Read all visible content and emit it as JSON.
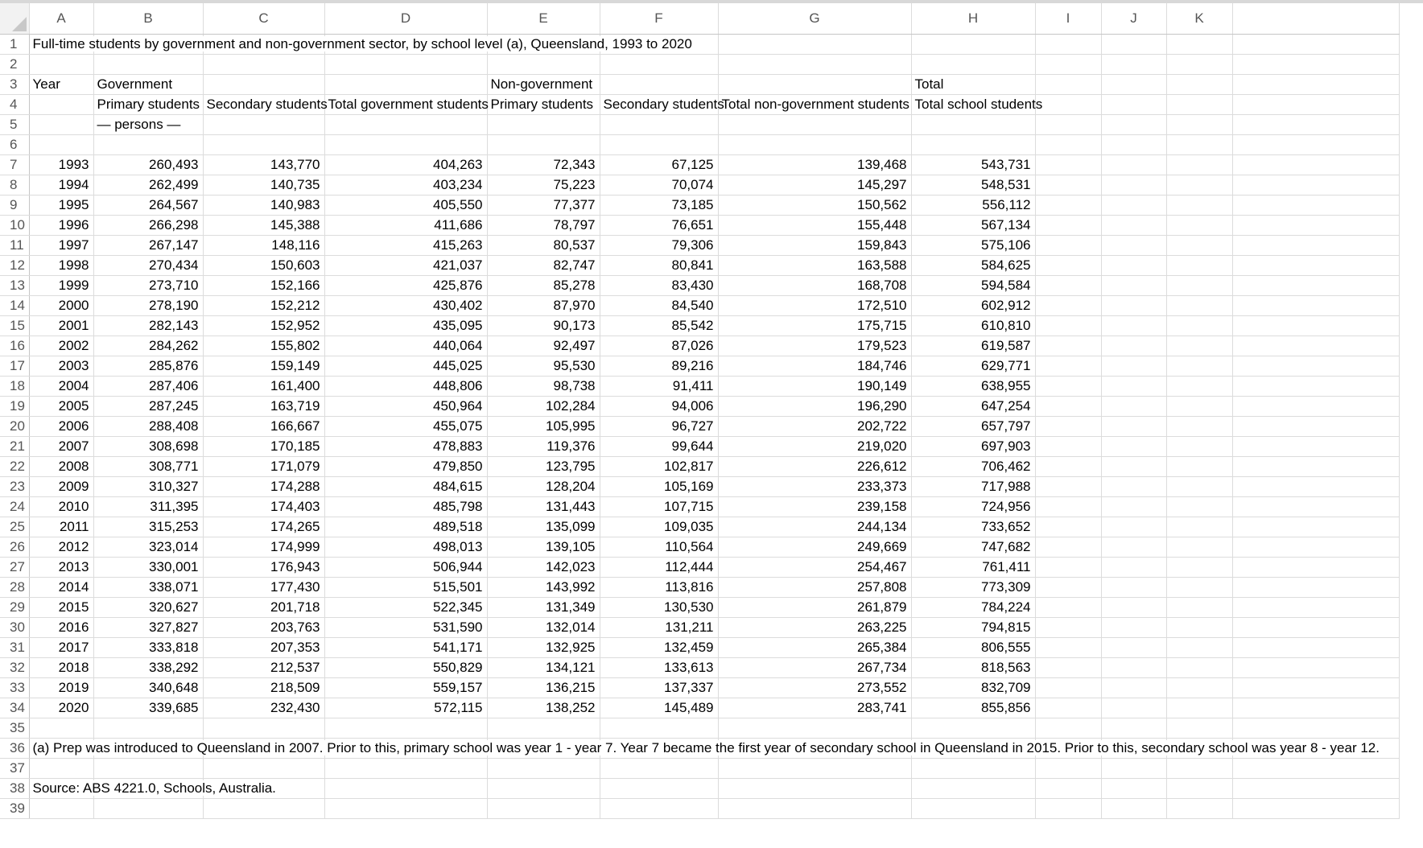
{
  "columns": [
    "A",
    "B",
    "C",
    "D",
    "E",
    "F",
    "G",
    "H",
    "I",
    "J",
    "K"
  ],
  "title": "Full-time students by government and non-government sector, by school level (a), Queensland, 1993 to 2020",
  "header_row3": {
    "A": "Year",
    "B": "Government",
    "E": "Non-government",
    "H": "Total"
  },
  "header_row4": {
    "B": "Primary students",
    "C": "Secondary students",
    "D": "Total government students",
    "E": "Primary students",
    "F": "Secondary students",
    "G": "Total non-government students",
    "H": "Total school students"
  },
  "units_row5": {
    "B": "— persons —"
  },
  "data_rows": [
    [
      "1993",
      "260,493",
      "143,770",
      "404,263",
      "72,343",
      "67,125",
      "139,468",
      "543,731"
    ],
    [
      "1994",
      "262,499",
      "140,735",
      "403,234",
      "75,223",
      "70,074",
      "145,297",
      "548,531"
    ],
    [
      "1995",
      "264,567",
      "140,983",
      "405,550",
      "77,377",
      "73,185",
      "150,562",
      "556,112"
    ],
    [
      "1996",
      "266,298",
      "145,388",
      "411,686",
      "78,797",
      "76,651",
      "155,448",
      "567,134"
    ],
    [
      "1997",
      "267,147",
      "148,116",
      "415,263",
      "80,537",
      "79,306",
      "159,843",
      "575,106"
    ],
    [
      "1998",
      "270,434",
      "150,603",
      "421,037",
      "82,747",
      "80,841",
      "163,588",
      "584,625"
    ],
    [
      "1999",
      "273,710",
      "152,166",
      "425,876",
      "85,278",
      "83,430",
      "168,708",
      "594,584"
    ],
    [
      "2000",
      "278,190",
      "152,212",
      "430,402",
      "87,970",
      "84,540",
      "172,510",
      "602,912"
    ],
    [
      "2001",
      "282,143",
      "152,952",
      "435,095",
      "90,173",
      "85,542",
      "175,715",
      "610,810"
    ],
    [
      "2002",
      "284,262",
      "155,802",
      "440,064",
      "92,497",
      "87,026",
      "179,523",
      "619,587"
    ],
    [
      "2003",
      "285,876",
      "159,149",
      "445,025",
      "95,530",
      "89,216",
      "184,746",
      "629,771"
    ],
    [
      "2004",
      "287,406",
      "161,400",
      "448,806",
      "98,738",
      "91,411",
      "190,149",
      "638,955"
    ],
    [
      "2005",
      "287,245",
      "163,719",
      "450,964",
      "102,284",
      "94,006",
      "196,290",
      "647,254"
    ],
    [
      "2006",
      "288,408",
      "166,667",
      "455,075",
      "105,995",
      "96,727",
      "202,722",
      "657,797"
    ],
    [
      "2007",
      "308,698",
      "170,185",
      "478,883",
      "119,376",
      "99,644",
      "219,020",
      "697,903"
    ],
    [
      "2008",
      "308,771",
      "171,079",
      "479,850",
      "123,795",
      "102,817",
      "226,612",
      "706,462"
    ],
    [
      "2009",
      "310,327",
      "174,288",
      "484,615",
      "128,204",
      "105,169",
      "233,373",
      "717,988"
    ],
    [
      "2010",
      "311,395",
      "174,403",
      "485,798",
      "131,443",
      "107,715",
      "239,158",
      "724,956"
    ],
    [
      "2011",
      "315,253",
      "174,265",
      "489,518",
      "135,099",
      "109,035",
      "244,134",
      "733,652"
    ],
    [
      "2012",
      "323,014",
      "174,999",
      "498,013",
      "139,105",
      "110,564",
      "249,669",
      "747,682"
    ],
    [
      "2013",
      "330,001",
      "176,943",
      "506,944",
      "142,023",
      "112,444",
      "254,467",
      "761,411"
    ],
    [
      "2014",
      "338,071",
      "177,430",
      "515,501",
      "143,992",
      "113,816",
      "257,808",
      "773,309"
    ],
    [
      "2015",
      "320,627",
      "201,718",
      "522,345",
      "131,349",
      "130,530",
      "261,879",
      "784,224"
    ],
    [
      "2016",
      "327,827",
      "203,763",
      "531,590",
      "132,014",
      "131,211",
      "263,225",
      "794,815"
    ],
    [
      "2017",
      "333,818",
      "207,353",
      "541,171",
      "132,925",
      "132,459",
      "265,384",
      "806,555"
    ],
    [
      "2018",
      "338,292",
      "212,537",
      "550,829",
      "134,121",
      "133,613",
      "267,734",
      "818,563"
    ],
    [
      "2019",
      "340,648",
      "218,509",
      "559,157",
      "136,215",
      "137,337",
      "273,552",
      "832,709"
    ],
    [
      "2020",
      "339,685",
      "232,430",
      "572,115",
      "138,252",
      "145,489",
      "283,741",
      "855,856"
    ]
  ],
  "footnote": "(a) Prep was introduced to Queensland in 2007. Prior to this, primary school was year 1 - year 7. Year 7 became the first year of secondary school in Queensland in 2015. Prior to this, secondary school was year 8 - year 12.",
  "source": "Source: ABS 4221.0, Schools, Australia.",
  "row_numbers_extra": [
    "35",
    "36",
    "37",
    "38",
    "39"
  ]
}
